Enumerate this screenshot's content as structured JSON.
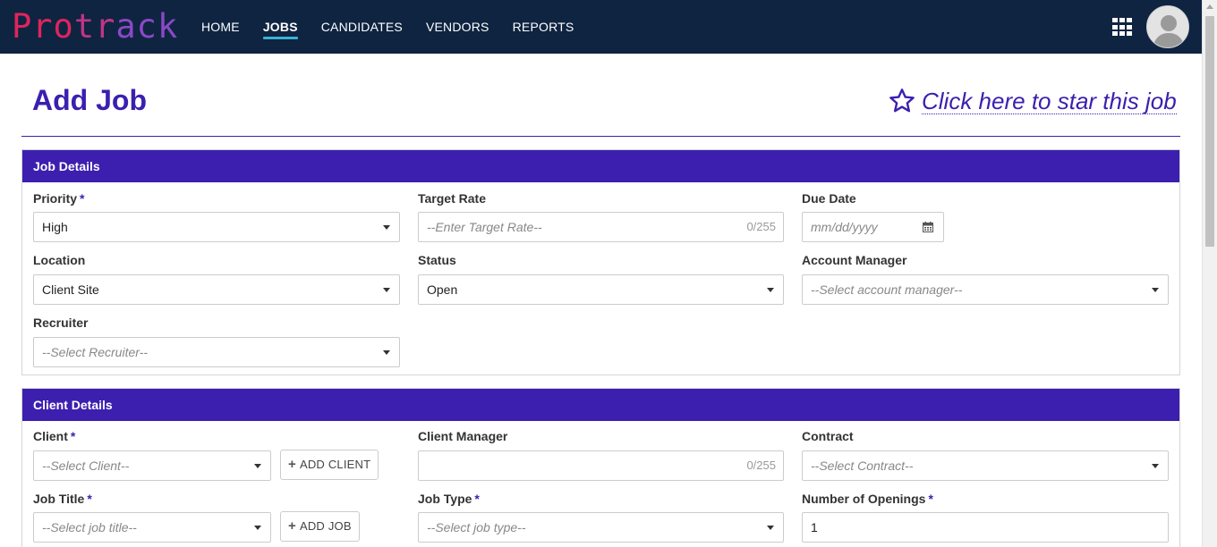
{
  "brand": {
    "logo_part1": "Pro",
    "logo_part2": "tr",
    "logo_part3": "ack"
  },
  "nav": {
    "home": "HOME",
    "jobs": "JOBS",
    "candidates": "CANDIDATES",
    "vendors": "VENDORS",
    "reports": "REPORTS"
  },
  "header": {
    "title": "Add Job",
    "star_label": "Click here to star this job"
  },
  "job_details": {
    "heading": "Job Details",
    "priority_label": "Priority",
    "priority_value": "High",
    "target_rate_label": "Target Rate",
    "target_rate_placeholder": "--Enter Target Rate--",
    "target_rate_counter": "0/255",
    "due_date_label": "Due Date",
    "due_date_placeholder": "mm/dd/yyyy",
    "location_label": "Location",
    "location_value": "Client Site",
    "status_label": "Status",
    "status_value": "Open",
    "account_manager_label": "Account Manager",
    "account_manager_placeholder": "--Select account manager--",
    "recruiter_label": "Recruiter",
    "recruiter_placeholder": "--Select Recruiter--"
  },
  "client_details": {
    "heading": "Client Details",
    "client_label": "Client",
    "client_placeholder": "--Select Client--",
    "add_client_label": "ADD CLIENT",
    "client_manager_label": "Client Manager",
    "client_manager_counter": "0/255",
    "contract_label": "Contract",
    "contract_placeholder": "--Select Contract--",
    "job_title_label": "Job Title",
    "job_title_placeholder": "--Select job title--",
    "add_job_label": "ADD JOB",
    "job_type_label": "Job Type",
    "job_type_placeholder": "--Select job type--",
    "openings_label": "Number of Openings",
    "openings_value": "1"
  },
  "required_marker": "*",
  "colors": {
    "nav_bg": "#0f2441",
    "accent": "#3c1faf",
    "active_underline": "#39b3d7"
  },
  "icons": [
    "apps-grid-icon",
    "avatar",
    "star-outline-icon",
    "calendar-icon",
    "chevron-down-icon",
    "plus-icon"
  ]
}
